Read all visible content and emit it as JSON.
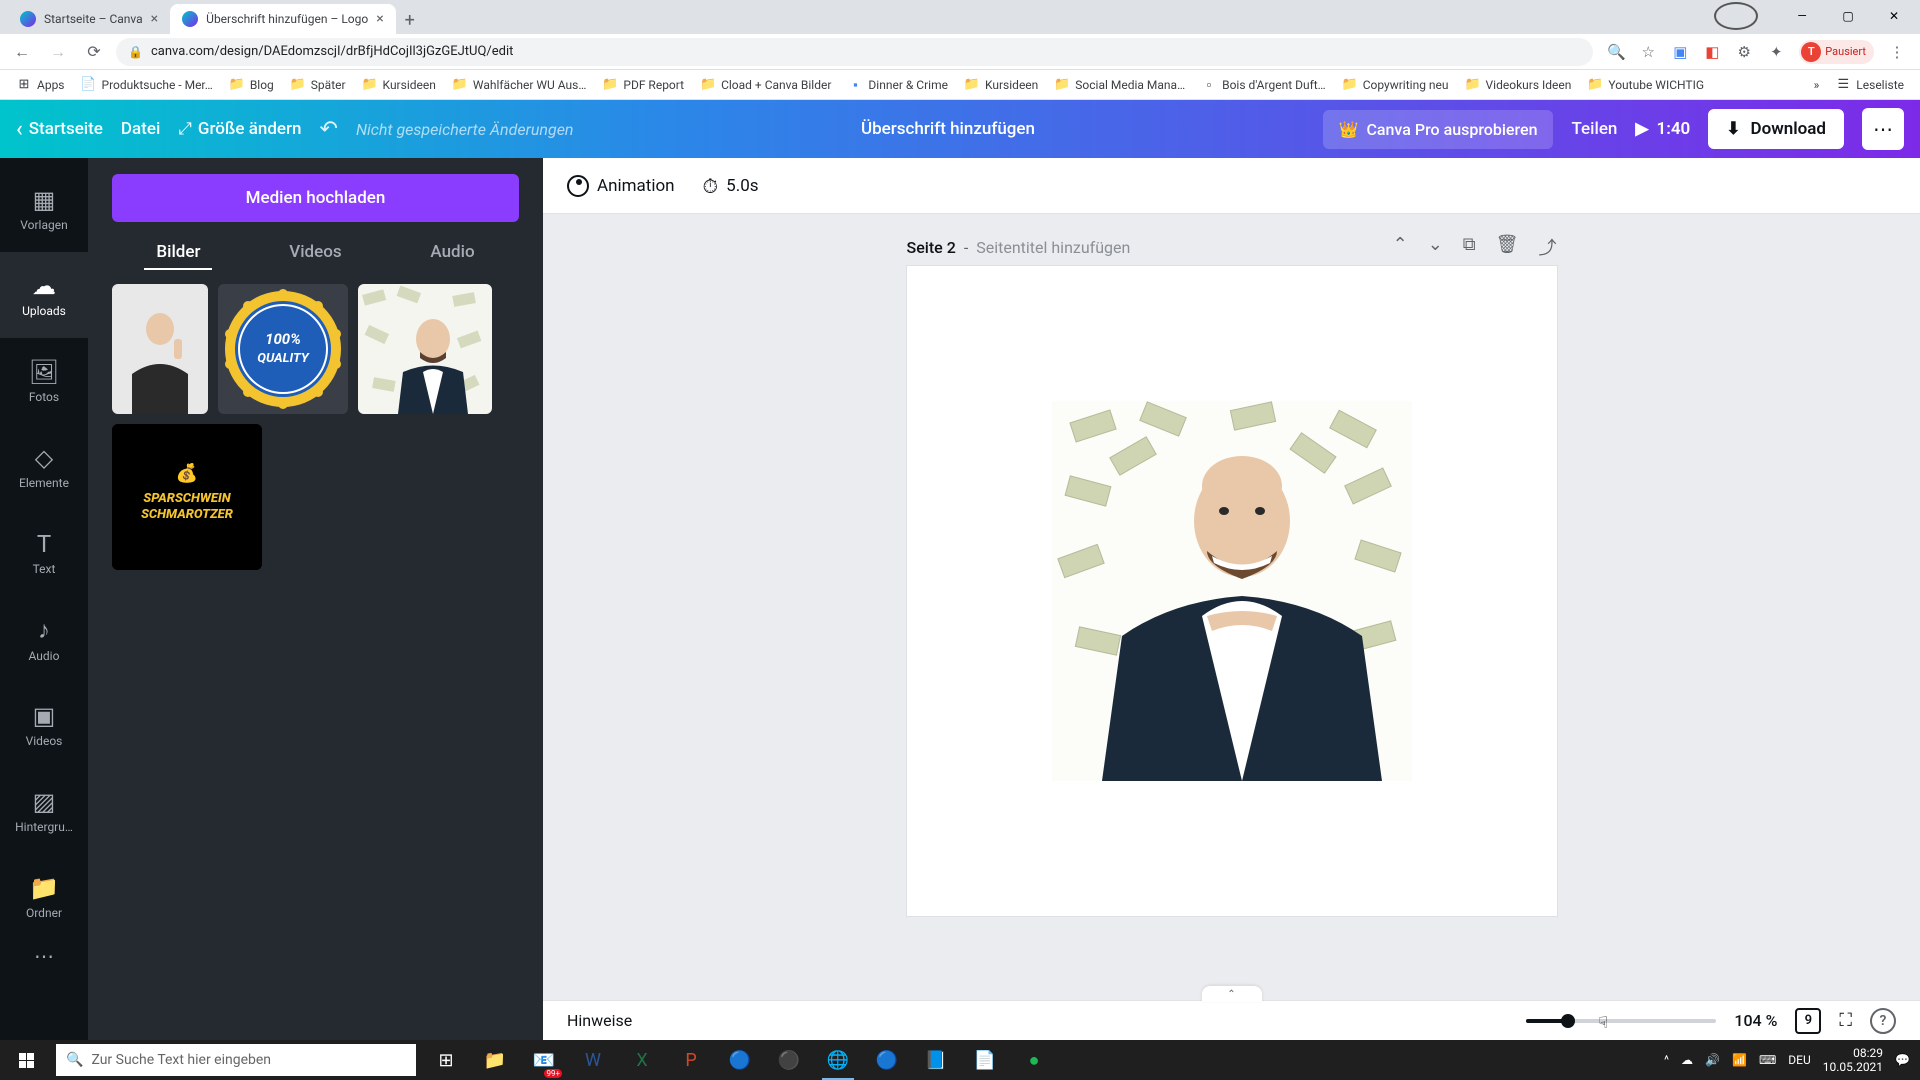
{
  "browser": {
    "tabs": [
      {
        "title": "Startseite – Canva",
        "active": false
      },
      {
        "title": "Überschrift hinzufügen – Logo",
        "active": true
      }
    ],
    "url": "canva.com/design/DAEdomzscjI/drBfjHdCojIl3jGzGEJtUQ/edit",
    "profile_status": "Pausiert",
    "profile_initial": "T"
  },
  "bookmarks": {
    "apps": "Apps",
    "items": [
      "Produktsuche - Mer…",
      "Blog",
      "Später",
      "Kursideen",
      "Wahlfächer WU Aus…",
      "PDF Report",
      "Cload + Canva Bilder",
      "Dinner & Crime",
      "Kursideen",
      "Social Media Mana…",
      "Bois d'Argent Duft…",
      "Copywriting neu",
      "Videokurs Ideen",
      "Youtube WICHTIG"
    ],
    "reading_list": "Leseliste"
  },
  "header": {
    "back": "Startseite",
    "file": "Datei",
    "resize": "Größe ändern",
    "unsaved": "Nicht gespeicherte Änderungen",
    "doc_title": "Überschrift hinzufügen",
    "pro": "Canva Pro ausprobieren",
    "share": "Teilen",
    "duration": "1:40",
    "download": "Download"
  },
  "rail": {
    "templates": "Vorlagen",
    "uploads": "Uploads",
    "photos": "Fotos",
    "elements": "Elemente",
    "text": "Text",
    "audio": "Audio",
    "videos": "Videos",
    "background": "Hintergru…",
    "folders": "Ordner"
  },
  "sidepanel": {
    "upload_btn": "Medien hochladen",
    "tabs": {
      "images": "Bilder",
      "videos": "Videos",
      "audio": "Audio"
    },
    "thumb4_line1": "SPARSCHWEIN",
    "thumb4_line2": "SCHMAROTZER",
    "thumb2_line1": "100%",
    "thumb2_line2": "QUALITY"
  },
  "toolbar": {
    "animation": "Animation",
    "timing": "5.0s"
  },
  "page": {
    "label": "Seite 2",
    "separator": " - ",
    "title_placeholder": "Seitentitel hinzufügen"
  },
  "bottom": {
    "notes": "Hinweise",
    "zoom_pct": "104 %",
    "page_num": "9"
  },
  "taskbar": {
    "search_placeholder": "Zur Suche Text hier eingeben",
    "lang": "DEU",
    "time": "08:29",
    "date": "10.05.2021",
    "notif": "99+"
  }
}
